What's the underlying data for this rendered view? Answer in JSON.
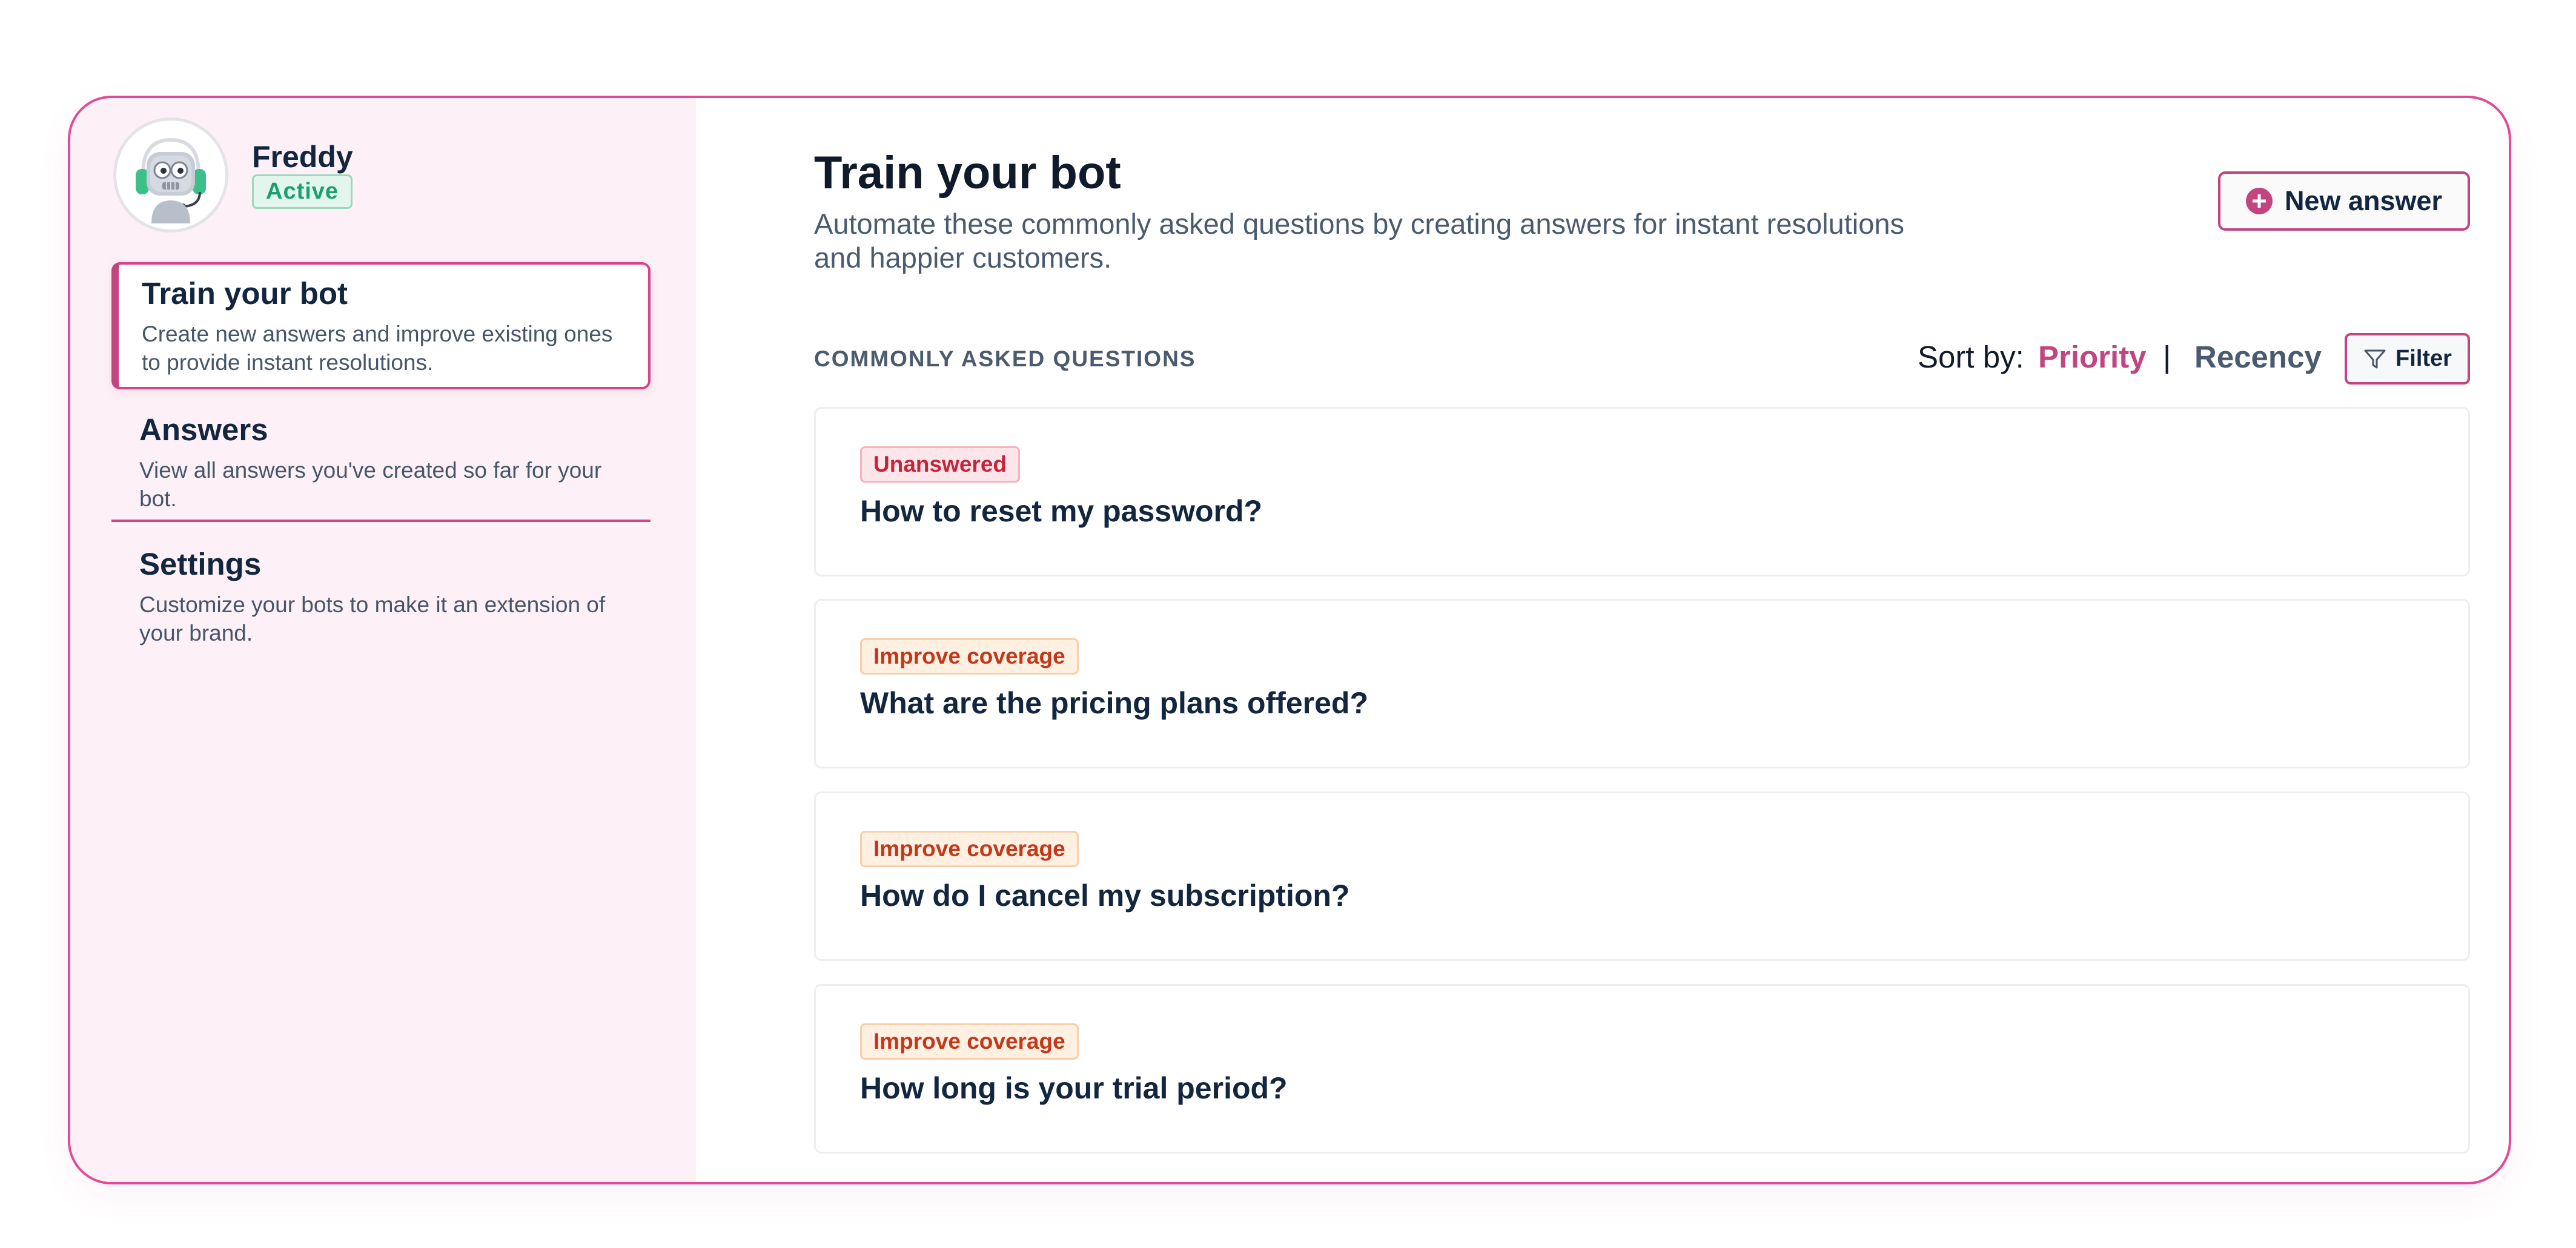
{
  "bot": {
    "name": "Freddy",
    "status": "Active"
  },
  "sidebar": {
    "items": [
      {
        "title": "Train your bot",
        "desc": "Create new answers and improve existing ones to provide instant resolutions."
      },
      {
        "title": "Answers",
        "desc": "View all answers you've created so far for your bot."
      },
      {
        "title": "Settings",
        "desc": "Customize your bots to make it an extension of your brand."
      }
    ]
  },
  "main": {
    "title": "Train your bot",
    "subtitle": "Automate these commonly asked questions by creating answers for instant resolutions and happier customers.",
    "new_answer_label": "New answer",
    "section_label": "COMMONLY ASKED QUESTIONS",
    "sort": {
      "label": "Sort by:",
      "priority": "Priority",
      "divider": "|",
      "recency": "Recency"
    },
    "filter_label": "Filter",
    "questions": [
      {
        "badge": "Unanswered",
        "text": "How to reset my password?"
      },
      {
        "badge": "Improve coverage",
        "text": "What are the pricing plans offered?"
      },
      {
        "badge": "Improve coverage",
        "text": "How do I cancel my subscription?"
      },
      {
        "badge": "Improve coverage",
        "text": "How long is your trial period?"
      }
    ]
  },
  "colors": {
    "accent": "#c2457f",
    "frame_border": "#e54896",
    "sidebar_bg": "#fdf0f6",
    "active_green": "#1aa06e",
    "unanswered_red": "#c6243a",
    "improve_orange": "#c1391a"
  },
  "icons": {
    "avatar": "robot-headset-icon",
    "new_answer": "plus-circle-icon",
    "filter": "funnel-icon"
  }
}
